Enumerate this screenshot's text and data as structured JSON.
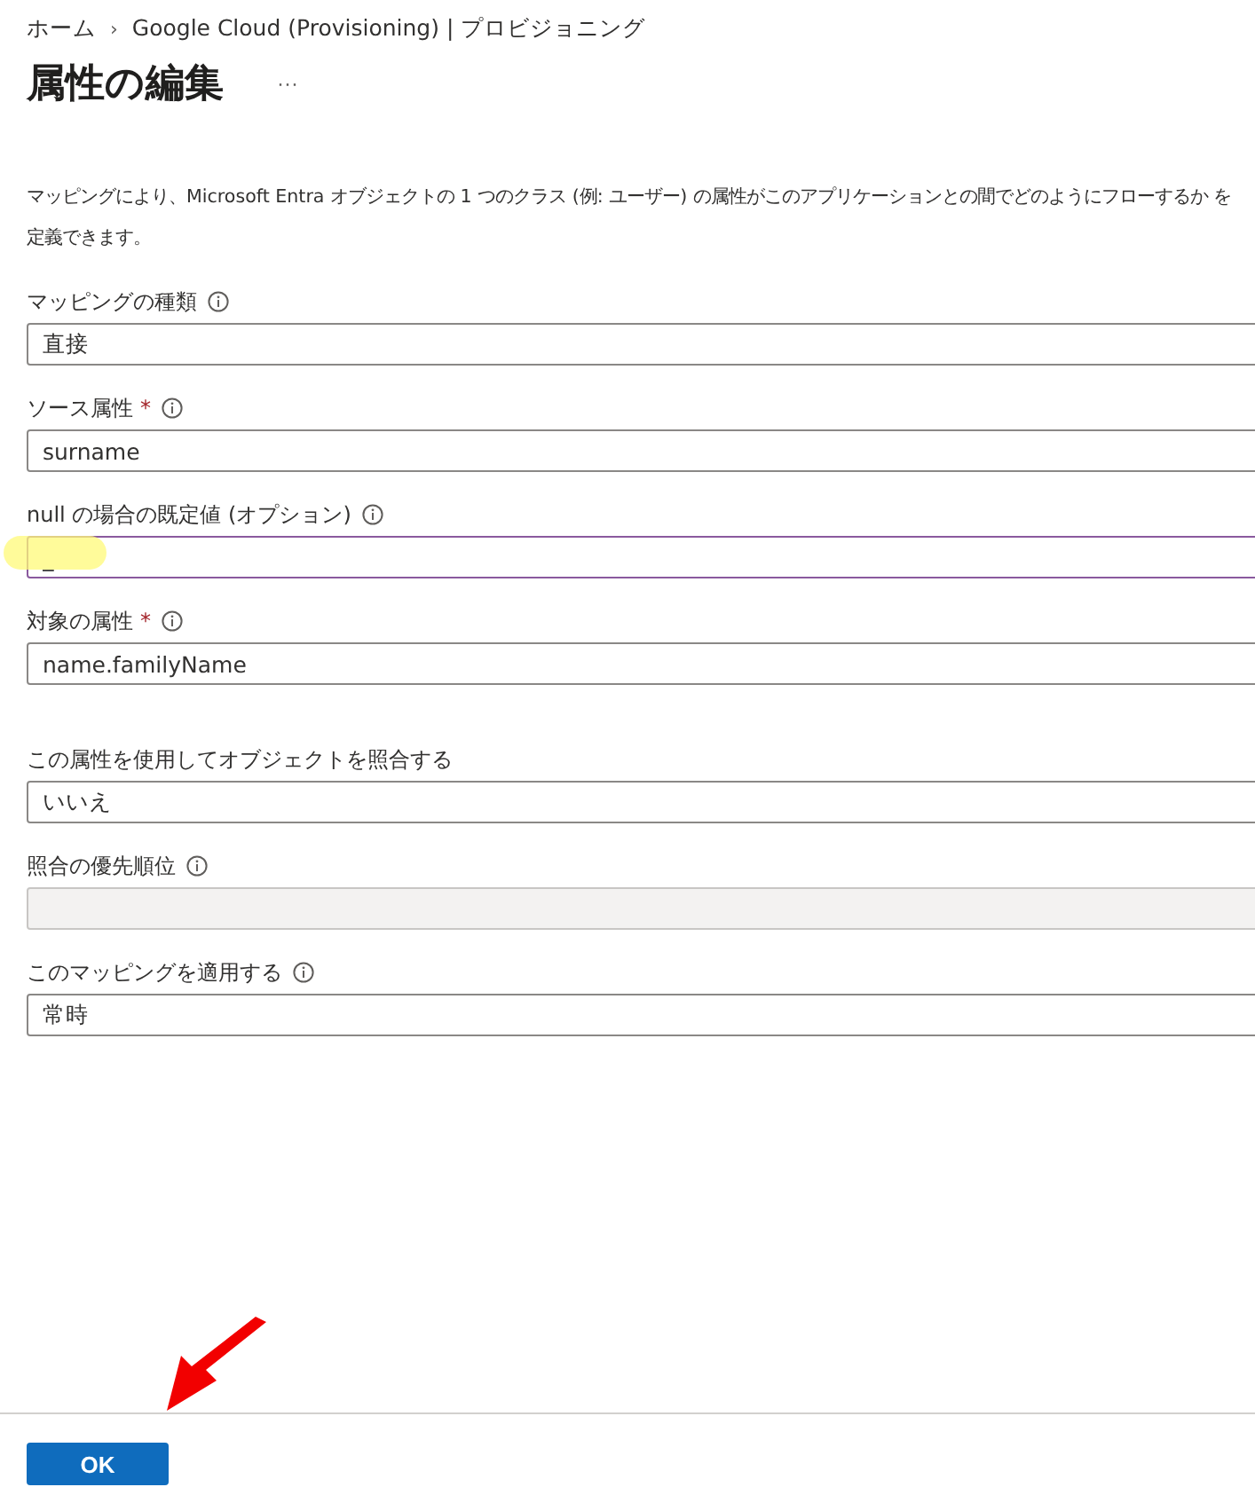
{
  "breadcrumb": [
    {
      "label": "ホーム"
    },
    {
      "label": "Google Cloud (Provisioning) | プロビジョニング"
    }
  ],
  "breadcrumb_separator": "›",
  "title": "属性の編集",
  "more": "···",
  "description": "マッピングにより、Microsoft Entra オブジェクトの 1 つのクラス (例: ユーザー) の属性がこのアプリケーションとの間でどのようにフローするか を定義できます。",
  "fields": [
    {
      "label": "マッピングの種類",
      "info": true,
      "kind": "select",
      "value": "直接",
      "focused": false,
      "disabled": false
    },
    {
      "label": "ソース属性",
      "required_mark": "*",
      "info": true,
      "kind": "select",
      "value": "surname",
      "focused": false,
      "disabled": false
    },
    {
      "label": "null の場合の既定値 (オプション)",
      "info": true,
      "kind": "text",
      "value": "_",
      "focused": true,
      "disabled": false
    },
    {
      "label": "対象の属性",
      "required_mark": "*",
      "info": true,
      "kind": "select",
      "value": "name.familyName",
      "focused": false,
      "disabled": false
    },
    {
      "label": "この属性を使用してオブジェクトを照合する",
      "info": false,
      "kind": "select",
      "value": "いいえ",
      "focused": false,
      "disabled": false
    },
    {
      "label": "照合の優先順位",
      "info": true,
      "kind": "text",
      "focused": false,
      "disabled": true
    },
    {
      "label": "このマッピングを適用する",
      "info": true,
      "kind": "select",
      "value": "常時",
      "focused": false,
      "disabled": false
    }
  ],
  "ok_button": "OK"
}
